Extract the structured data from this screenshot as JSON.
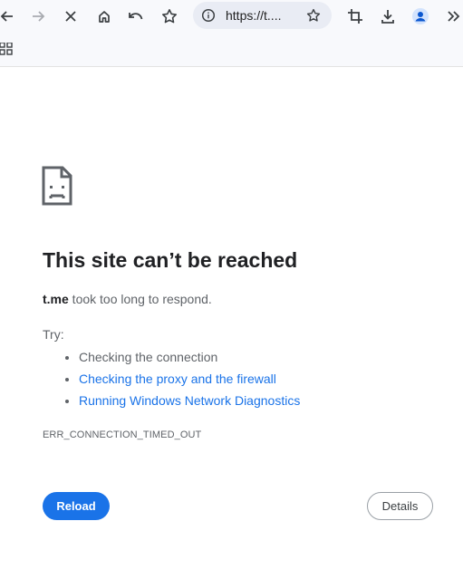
{
  "toolbar": {
    "back_icon": "arrow-left-icon",
    "forward_icon": "arrow-right-icon",
    "stop_icon": "close-icon",
    "home_icon": "home-icon",
    "undo_icon": "undo-icon",
    "star_icon": "star-icon",
    "url": "https://t....",
    "extensions": [
      "crop-icon",
      "download-icon",
      "profile-icon",
      "chevron-double-right-icon"
    ]
  },
  "bookmarks": {
    "apps_icon": "apps-grid-icon"
  },
  "error": {
    "icon": "sad-page-icon",
    "title": "This site can’t be reached",
    "host": "t.me",
    "message": " took too long to respond.",
    "try_label": "Try:",
    "suggestions": [
      {
        "text": "Checking the connection",
        "link": false
      },
      {
        "text": "Checking the proxy and the firewall",
        "link": true
      },
      {
        "text": "Running Windows Network Diagnostics",
        "link": true
      }
    ],
    "code": "ERR_CONNECTION_TIMED_OUT",
    "reload_label": "Reload",
    "details_label": "Details"
  },
  "colors": {
    "accent": "#1a73e8",
    "text": "#202124",
    "secondary_text": "#5f6368",
    "toolbar_bg": "#f8f9fc"
  }
}
